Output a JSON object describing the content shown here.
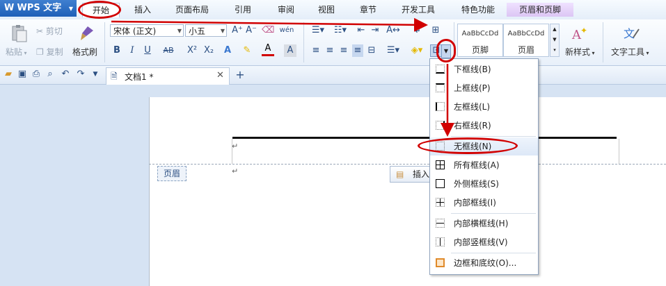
{
  "app": {
    "logo_text": "WPS 文字",
    "logo_letter": "W"
  },
  "tabs": [
    {
      "label": "开始"
    },
    {
      "label": "插入"
    },
    {
      "label": "页面布局"
    },
    {
      "label": "引用"
    },
    {
      "label": "审阅"
    },
    {
      "label": "视图"
    },
    {
      "label": "章节"
    },
    {
      "label": "开发工具"
    },
    {
      "label": "特色功能"
    },
    {
      "label": "页眉和页脚"
    }
  ],
  "ribbon": {
    "paste": "粘贴",
    "cut": "剪切",
    "copy": "复制",
    "format_painter": "格式刷",
    "font_name": "宋体 (正文)",
    "font_size": "小五",
    "bold": "B",
    "italic": "I",
    "underline": "U",
    "strike": "AB",
    "superscript": "X²",
    "subscript": "X₂",
    "style_preview_1": "AaBbCcDd",
    "style_name_1": "页脚",
    "style_preview_2": "AaBbCcDd",
    "style_name_2": "页眉",
    "new_style": "新样式",
    "text_tools": "文字工具"
  },
  "doc": {
    "tab_title": "文档1 *",
    "header_label": "页眉",
    "insert_label": "插入",
    "para_mark": "↵"
  },
  "menu": {
    "items": [
      {
        "label": "下框线(B)"
      },
      {
        "label": "上框线(P)"
      },
      {
        "label": "左框线(L)"
      },
      {
        "label": "右框线(R)"
      },
      {
        "label": "无框线(N)"
      },
      {
        "label": "所有框线(A)"
      },
      {
        "label": "外侧框线(S)"
      },
      {
        "label": "内部框线(I)"
      },
      {
        "label": "内部横框线(H)"
      },
      {
        "label": "内部竖框线(V)"
      },
      {
        "label": "边框和底纹(O)..."
      }
    ]
  },
  "colors": {
    "annotation_red": "#d10000",
    "accent_blue": "#1e5fb8"
  }
}
